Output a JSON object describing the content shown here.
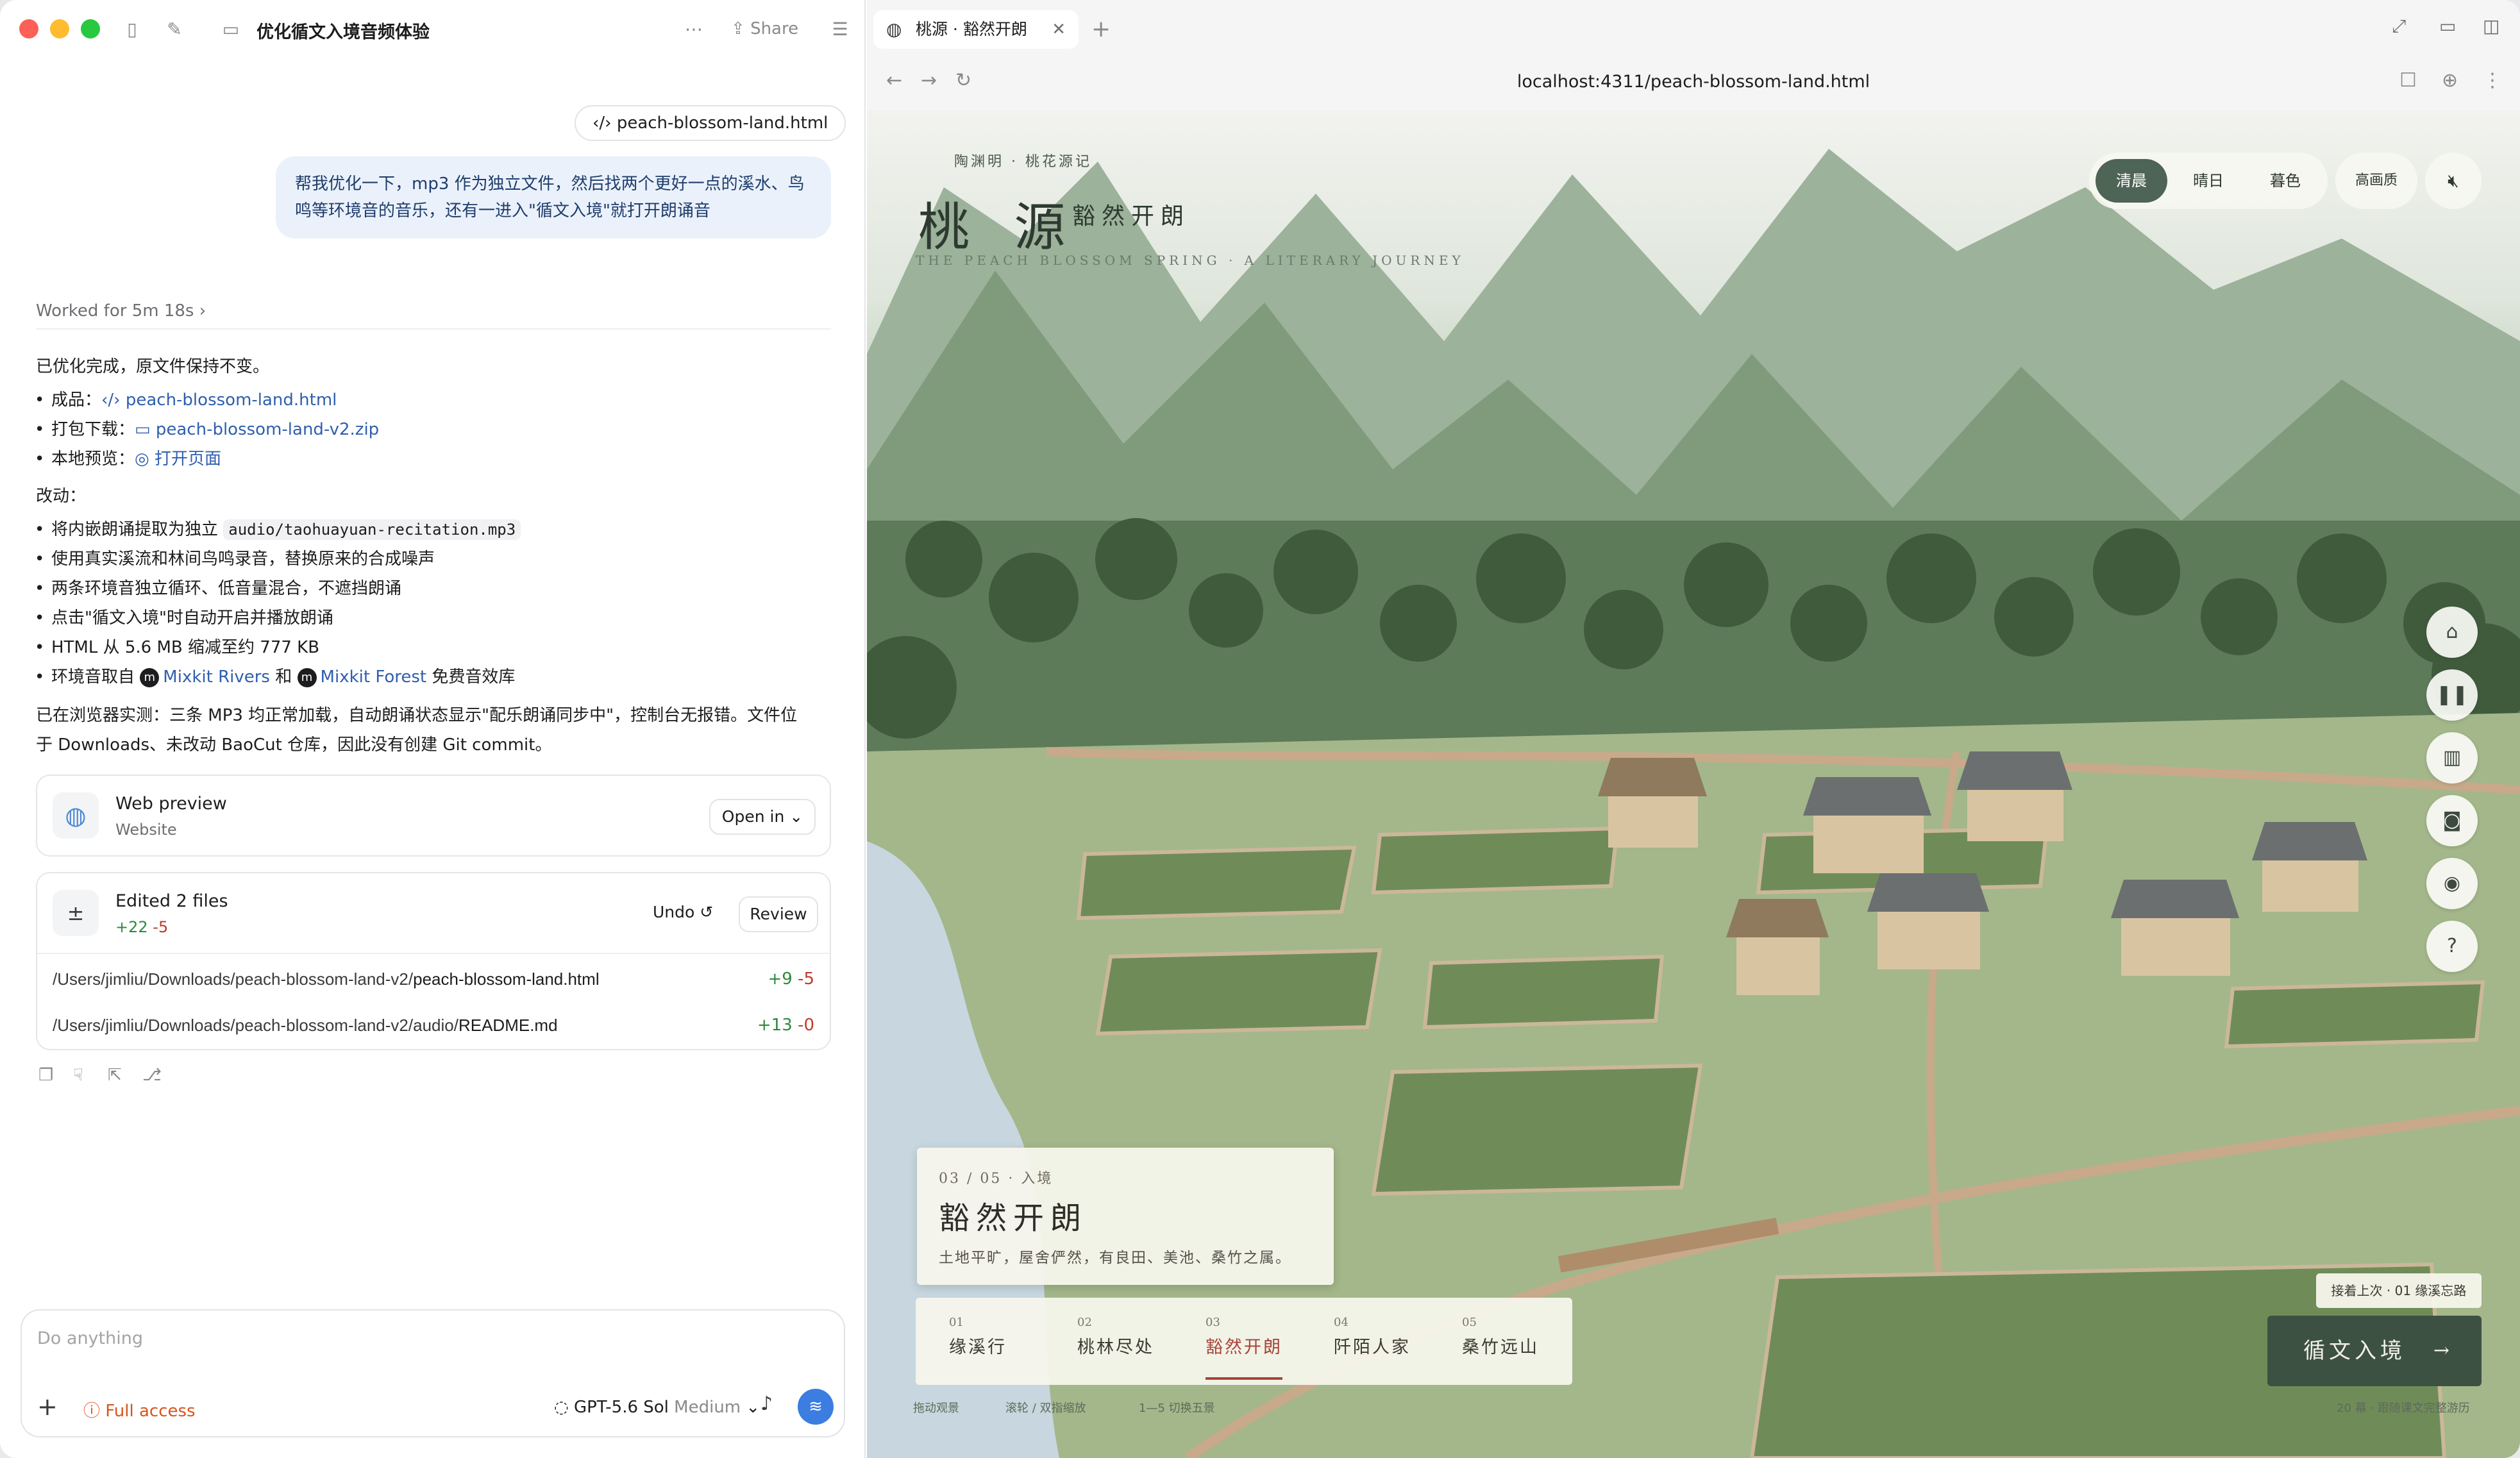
{
  "left": {
    "thread_title": "优化循文入境音频体验",
    "share_label": "Share",
    "file_chip": "peach-blossom-land.html",
    "user_message": "帮我优化一下，mp3 作为独立文件，然后找两个更好一点的溪水、鸟鸣等环境音的音乐，还有一进入\"循文入境\"就打开朗诵音",
    "worked_for": "Worked for 5m 18s",
    "done_line": "已优化完成，原文件保持不变。",
    "deliverables": [
      {
        "label": "成品：",
        "link": "peach-blossom-land.html"
      },
      {
        "label": "打包下载：",
        "link": "peach-blossom-land-v2.zip"
      },
      {
        "label": "本地预览：",
        "link": "打开页面"
      }
    ],
    "changes_heading": "改动：",
    "change_1_prefix": "将内嵌朗诵提取为独立",
    "change_1_code": "audio/taohuayuan-recitation.mp3",
    "change_2": "使用真实溪流和林间鸟鸣录音，替换原来的合成噪声",
    "change_3": "两条环境音独立循环、低音量混合，不遮挡朗诵",
    "change_4": "点击\"循文入境\"时自动开启并播放朗诵",
    "change_5": "HTML 从 5.6 MB 缩减至约 777 KB",
    "change_6_prefix": "环境音取自",
    "change_6_link1": "Mixkit Rivers",
    "change_6_and": "和",
    "change_6_link2": "Mixkit Forest",
    "change_6_suffix": "免费音效库",
    "summary_1": "已在浏览器实测：三条 MP3 均正常加载，自动朗诵状态显示\"配乐朗诵同步中\"，控制台无报错。文件位",
    "summary_2": "于 Downloads、未改动 BaoCut 仓库，因此没有创建 Git commit。",
    "preview_card": {
      "title": "Web preview",
      "subtitle": "Website",
      "button": "Open in"
    },
    "edits_card": {
      "title": "Edited 2 files",
      "added": "+22",
      "removed": "-5",
      "undo": "Undo",
      "review": "Review",
      "files": [
        {
          "dir": "/Users/jimliu/Downloads/peach-blossom-land-v2/",
          "name": "peach-blossom-land.html",
          "added": "+9",
          "removed": "-5"
        },
        {
          "dir": "/Users/jimliu/Downloads/peach-blossom-land-v2/audio/",
          "name": "README.md",
          "added": "+13",
          "removed": "-0"
        }
      ]
    },
    "composer": {
      "placeholder": "Do anything",
      "access": "Full access",
      "model": "GPT-5.6 Sol",
      "effort": "Medium"
    }
  },
  "browser": {
    "tab_title": "桃源 · 豁然开朗",
    "url": "localhost:4311/peach-blossom-land.html"
  },
  "scene": {
    "subtitle": "陶渊明 · 桃花源记",
    "title_main": "桃 源",
    "title_side": "豁然开朗",
    "title_en": "THE PEACH BLOSSOM SPRING · A LITERARY JOURNEY",
    "time_modes": [
      "清晨",
      "晴日",
      "暮色"
    ],
    "active_mode": "清晨",
    "quality": "高画质",
    "side_buttons": [
      "home-icon",
      "pause-icon",
      "book-icon",
      "camera-icon",
      "eye-icon",
      "help-icon"
    ],
    "chapter": {
      "index": "03 / 05 · 入境",
      "title": "豁然开朗",
      "description": "土地平旷，屋舍俨然，有良田、美池、桑竹之属。"
    },
    "steps": [
      {
        "num": "01",
        "label": "缘溪行"
      },
      {
        "num": "02",
        "label": "桃林尽处"
      },
      {
        "num": "03",
        "label": "豁然开朗"
      },
      {
        "num": "04",
        "label": "阡陌人家"
      },
      {
        "num": "05",
        "label": "桑竹远山"
      }
    ],
    "active_step": "03",
    "resume": "接着上次 · 01 缘溪忘路",
    "enter_button": "循文入境",
    "hints": [
      "拖动观景",
      "滚轮 / 双指缩放",
      "1—5 切换五景"
    ],
    "hint_right": "20 幕 · 跟随课文完整游历"
  }
}
